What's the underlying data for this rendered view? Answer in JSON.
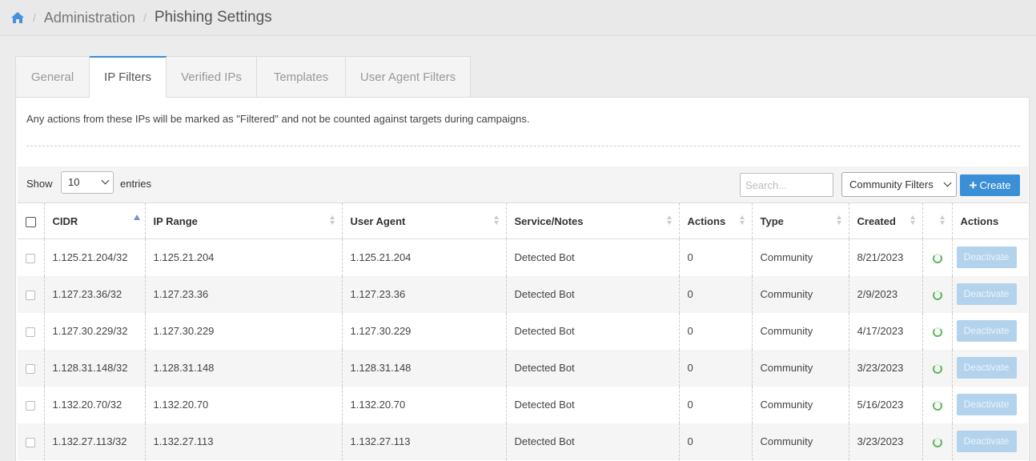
{
  "breadcrumb": {
    "items": [
      "Administration",
      "Phishing Settings"
    ]
  },
  "tabs": [
    {
      "label": "General",
      "active": false
    },
    {
      "label": "IP Filters",
      "active": true
    },
    {
      "label": "Verified IPs",
      "active": false
    },
    {
      "label": "Templates",
      "active": false
    },
    {
      "label": "User Agent Filters",
      "active": false
    }
  ],
  "description": "Any actions from these IPs will be marked as \"Filtered\" and not be counted against targets during campaigns.",
  "toolbar": {
    "show_label": "Show",
    "page_size": "10",
    "entries_label": "entries",
    "search_placeholder": "Search...",
    "filter_value": "Community Filters",
    "create_label": "Create"
  },
  "table": {
    "columns": [
      "CIDR",
      "IP Range",
      "User Agent",
      "Service/Notes",
      "Actions",
      "Type",
      "Created",
      "",
      "Actions"
    ],
    "sorted_column": "CIDR",
    "rows": [
      {
        "cidr": "1.125.21.204/32",
        "ip_range": "1.125.21.204",
        "user_agent": "1.125.21.204",
        "notes": "Detected Bot",
        "actions": "0",
        "type": "Community",
        "created": "8/21/2023",
        "button": "Deactivate"
      },
      {
        "cidr": "1.127.23.36/32",
        "ip_range": "1.127.23.36",
        "user_agent": "1.127.23.36",
        "notes": "Detected Bot",
        "actions": "0",
        "type": "Community",
        "created": "2/9/2023",
        "button": "Deactivate"
      },
      {
        "cidr": "1.127.30.229/32",
        "ip_range": "1.127.30.229",
        "user_agent": "1.127.30.229",
        "notes": "Detected Bot",
        "actions": "0",
        "type": "Community",
        "created": "4/17/2023",
        "button": "Deactivate"
      },
      {
        "cidr": "1.128.31.148/32",
        "ip_range": "1.128.31.148",
        "user_agent": "1.128.31.148",
        "notes": "Detected Bot",
        "actions": "0",
        "type": "Community",
        "created": "3/23/2023",
        "button": "Deactivate"
      },
      {
        "cidr": "1.132.20.70/32",
        "ip_range": "1.132.20.70",
        "user_agent": "1.132.20.70",
        "notes": "Detected Bot",
        "actions": "0",
        "type": "Community",
        "created": "5/16/2023",
        "button": "Deactivate"
      },
      {
        "cidr": "1.132.27.113/32",
        "ip_range": "1.132.27.113",
        "user_agent": "1.132.27.113",
        "notes": "Detected Bot",
        "actions": "0",
        "type": "Community",
        "created": "3/23/2023",
        "button": "Deactivate"
      }
    ]
  },
  "colors": {
    "accent": "#3a8fd6",
    "status_active": "#5cb85c",
    "disabled_button": "#b3d3ec"
  },
  "icons": {
    "home": "home-icon",
    "status": "status-active-icon"
  }
}
